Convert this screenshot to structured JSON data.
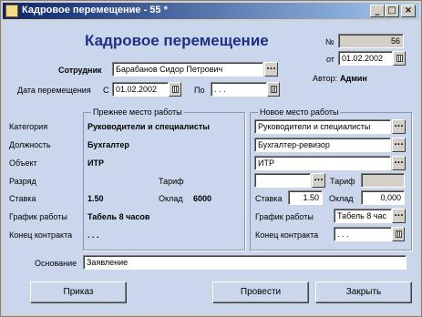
{
  "window": {
    "title": "Кадровое перемещение - 55 *"
  },
  "header": {
    "title": "Кадровое перемещение",
    "number_label": "№",
    "number": "56",
    "date_label": "от",
    "date": "01.02.2002",
    "author_label": "Автор:",
    "author": "Админ"
  },
  "employee": {
    "label": "Сотрудник",
    "value": "Барабанов Сидор Петрович"
  },
  "transfer": {
    "label": "Дата перемещения",
    "from_label": "С",
    "from": "01.02.2002",
    "to_label": "По",
    "to": ". . ."
  },
  "rows": {
    "category": "Категория",
    "position": "Должность",
    "object": "Объект",
    "rank": "Разряд",
    "rate": "Ставка",
    "schedule": "График работы",
    "contract_end": "Конец контракта"
  },
  "old_place": {
    "title": "Прежнее место работы",
    "category": "Руководители и специалисты",
    "position": "Бухгалтер",
    "object": "ИТР",
    "tariff_label": "Тариф",
    "rate": "1.50",
    "salary_label": "Оклад",
    "salary": "6000",
    "schedule": "Табель 8 часов",
    "contract_end": ". . ."
  },
  "new_place": {
    "title": "Новое место работы",
    "category": "Руководители и специалисты",
    "position": "Бухгалтер-ревизор",
    "object": "ИТР",
    "rank": "",
    "tariff_label": "Тариф",
    "tariff": "",
    "rate_label": "Ставка",
    "rate": "1.50",
    "salary_label": "Оклад",
    "salary": "0,000",
    "schedule_label": "График работы",
    "schedule": "Табель 8 час",
    "contract_label": "Конец контракта",
    "contract_end": ". . ."
  },
  "basis": {
    "label": "Основание",
    "value": "Заявление"
  },
  "buttons": {
    "order": "Приказ",
    "post": "Провести",
    "close": "Закрыть"
  },
  "colors": {
    "accent": "#1f2f8a",
    "client_bg": "#c9d6ec",
    "titlebar": "#0a246a"
  }
}
